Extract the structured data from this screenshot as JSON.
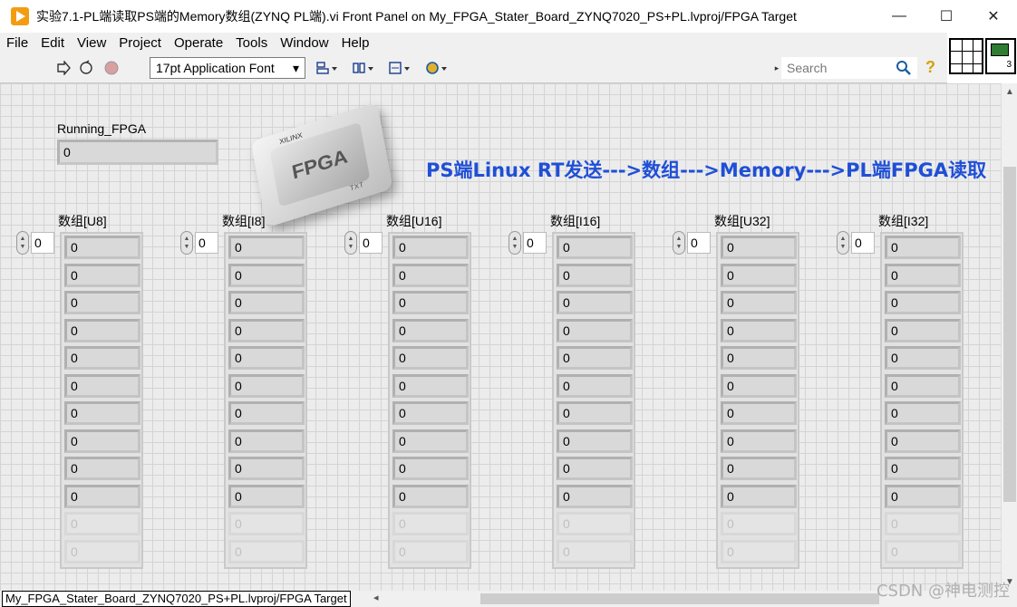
{
  "window": {
    "title": "实验7.1-PL端读取PS端的Memory数组(ZYNQ PL端).vi Front Panel on My_FPGA_Stater_Board_ZYNQ7020_PS+PL.lvproj/FPGA Target",
    "minimize": "—",
    "maximize": "☐",
    "close": "✕"
  },
  "menu": [
    {
      "label": "File"
    },
    {
      "label": "Edit"
    },
    {
      "label": "View"
    },
    {
      "label": "Project"
    },
    {
      "label": "Operate"
    },
    {
      "label": "Tools"
    },
    {
      "label": "Window"
    },
    {
      "label": "Help"
    }
  ],
  "toolbar": {
    "font": "17pt Application Font",
    "search_placeholder": "Search",
    "vi_icon_number": "3"
  },
  "panel": {
    "running_label": "Running_FPGA",
    "running_value": "0",
    "chip_text": "FPGA",
    "chip_brand": "XILINX",
    "chip_sub": "TXT",
    "heading": "PS端Linux RT发送--->数组--->Memory--->PL端FPGA读取"
  },
  "arrays": [
    {
      "label": "数组[U8]",
      "index": "0"
    },
    {
      "label": "数组[I8]",
      "index": "0"
    },
    {
      "label": "数组[U16]",
      "index": "0"
    },
    {
      "label": "数组[I16]",
      "index": "0"
    },
    {
      "label": "数组[U32]",
      "index": "0"
    },
    {
      "label": "数组[I32]",
      "index": "0"
    }
  ],
  "array_values": [
    "0",
    "0",
    "0",
    "0",
    "0",
    "0",
    "0",
    "0",
    "0",
    "0",
    "0",
    "0"
  ],
  "active_elements": 10,
  "statusbar": {
    "path": "My_FPGA_Stater_Board_ZYNQ7020_PS+PL.lvproj/FPGA Target"
  },
  "watermark": "CSDN @神电测控"
}
